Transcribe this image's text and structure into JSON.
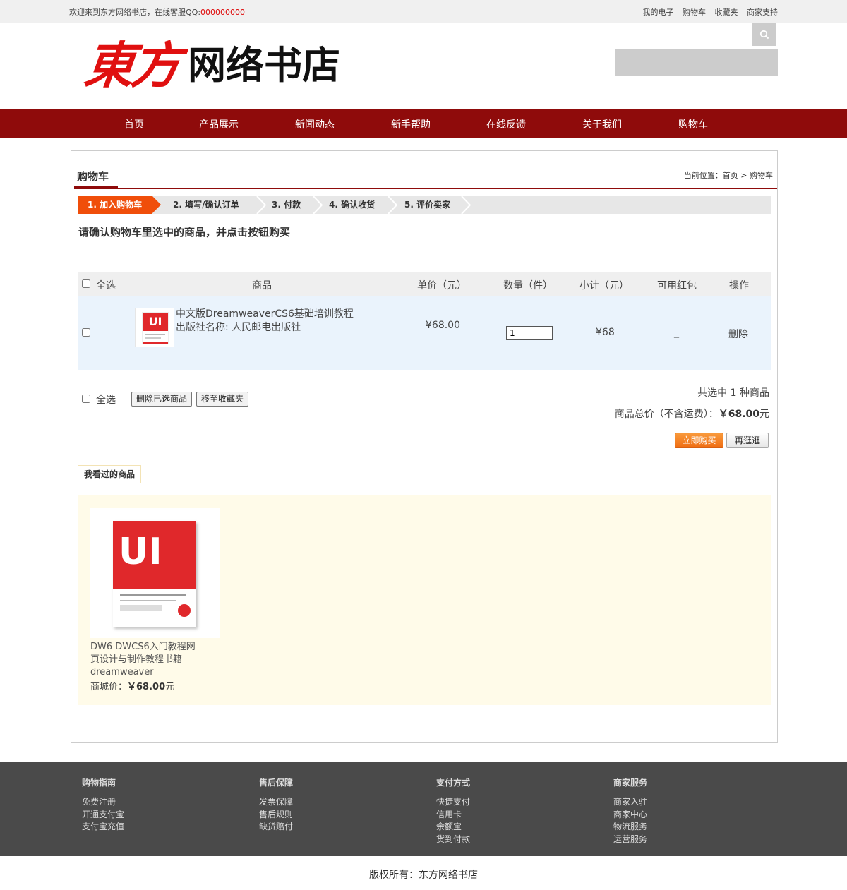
{
  "topbar": {
    "welcome": "欢迎来到东方网络书店，在线客服QQ:",
    "qq": "000000000",
    "links": [
      "我的电子",
      "购物车",
      "收藏夹",
      "商家支持"
    ]
  },
  "logo": {
    "red": "東方",
    "black": "网络书店"
  },
  "search": {
    "placeholder": ""
  },
  "nav": [
    "首页",
    "产品展示",
    "新闻动态",
    "新手帮助",
    "在线反馈",
    "关于我们",
    "购物车"
  ],
  "page": {
    "title": "购物车",
    "breadcrumb": "当前位置：首页 > 购物车",
    "steps": [
      "1. 加入购物车",
      "2. 填写/确认订单",
      "3. 付款",
      "4. 确认收货",
      "5. 评价卖家"
    ],
    "confirm": "请确认购物车里选中的商品，并点击按钮购买"
  },
  "table": {
    "headers": {
      "select_all": "全选",
      "product": "商品",
      "unit_price": "单价（元）",
      "qty": "数量（件）",
      "subtotal": "小计（元）",
      "coupon": "可用红包",
      "action": "操作"
    },
    "row": {
      "name": "中文版DreamweaverCS6基础培训教程",
      "publisher": "出版社名称: 人民邮电出版社",
      "price": "¥68.00",
      "qty": "1",
      "subtotal": "¥68",
      "coupon": "_",
      "action": "删除",
      "thumb_text": "UI"
    }
  },
  "summary": {
    "select_all": "全选",
    "delete_selected": "删除已选商品",
    "move_fav": "移至收藏夹",
    "count_text": "共选中 1 种商品",
    "total_label": "商品总价（不含运费）：",
    "total_value": "￥68.00",
    "total_unit": "元",
    "buy": "立即购买",
    "again": "再逛逛"
  },
  "viewed": {
    "tab": "我看过的商品",
    "item": {
      "cover_text": "UI",
      "title": "DW6 DWCS6入门教程网页设计与制作教程书籍dreamweaver",
      "price_label": "商城价：",
      "price": "￥68.00",
      "price_unit": "元"
    }
  },
  "footer": {
    "cols": [
      {
        "h": "购物指南",
        "items": [
          "免费注册",
          "开通支付宝",
          "支付宝充值"
        ]
      },
      {
        "h": "售后保障",
        "items": [
          "发票保障",
          "售后规则",
          "缺货赔付"
        ]
      },
      {
        "h": "支付方式",
        "items": [
          "快捷支付",
          "信用卡",
          "余额宝",
          "货到付款"
        ]
      },
      {
        "h": "商家服务",
        "items": [
          "商家入驻",
          "商家中心",
          "物流服务",
          "运营服务"
        ]
      }
    ],
    "copyright": "版权所有：东方网络书店"
  }
}
